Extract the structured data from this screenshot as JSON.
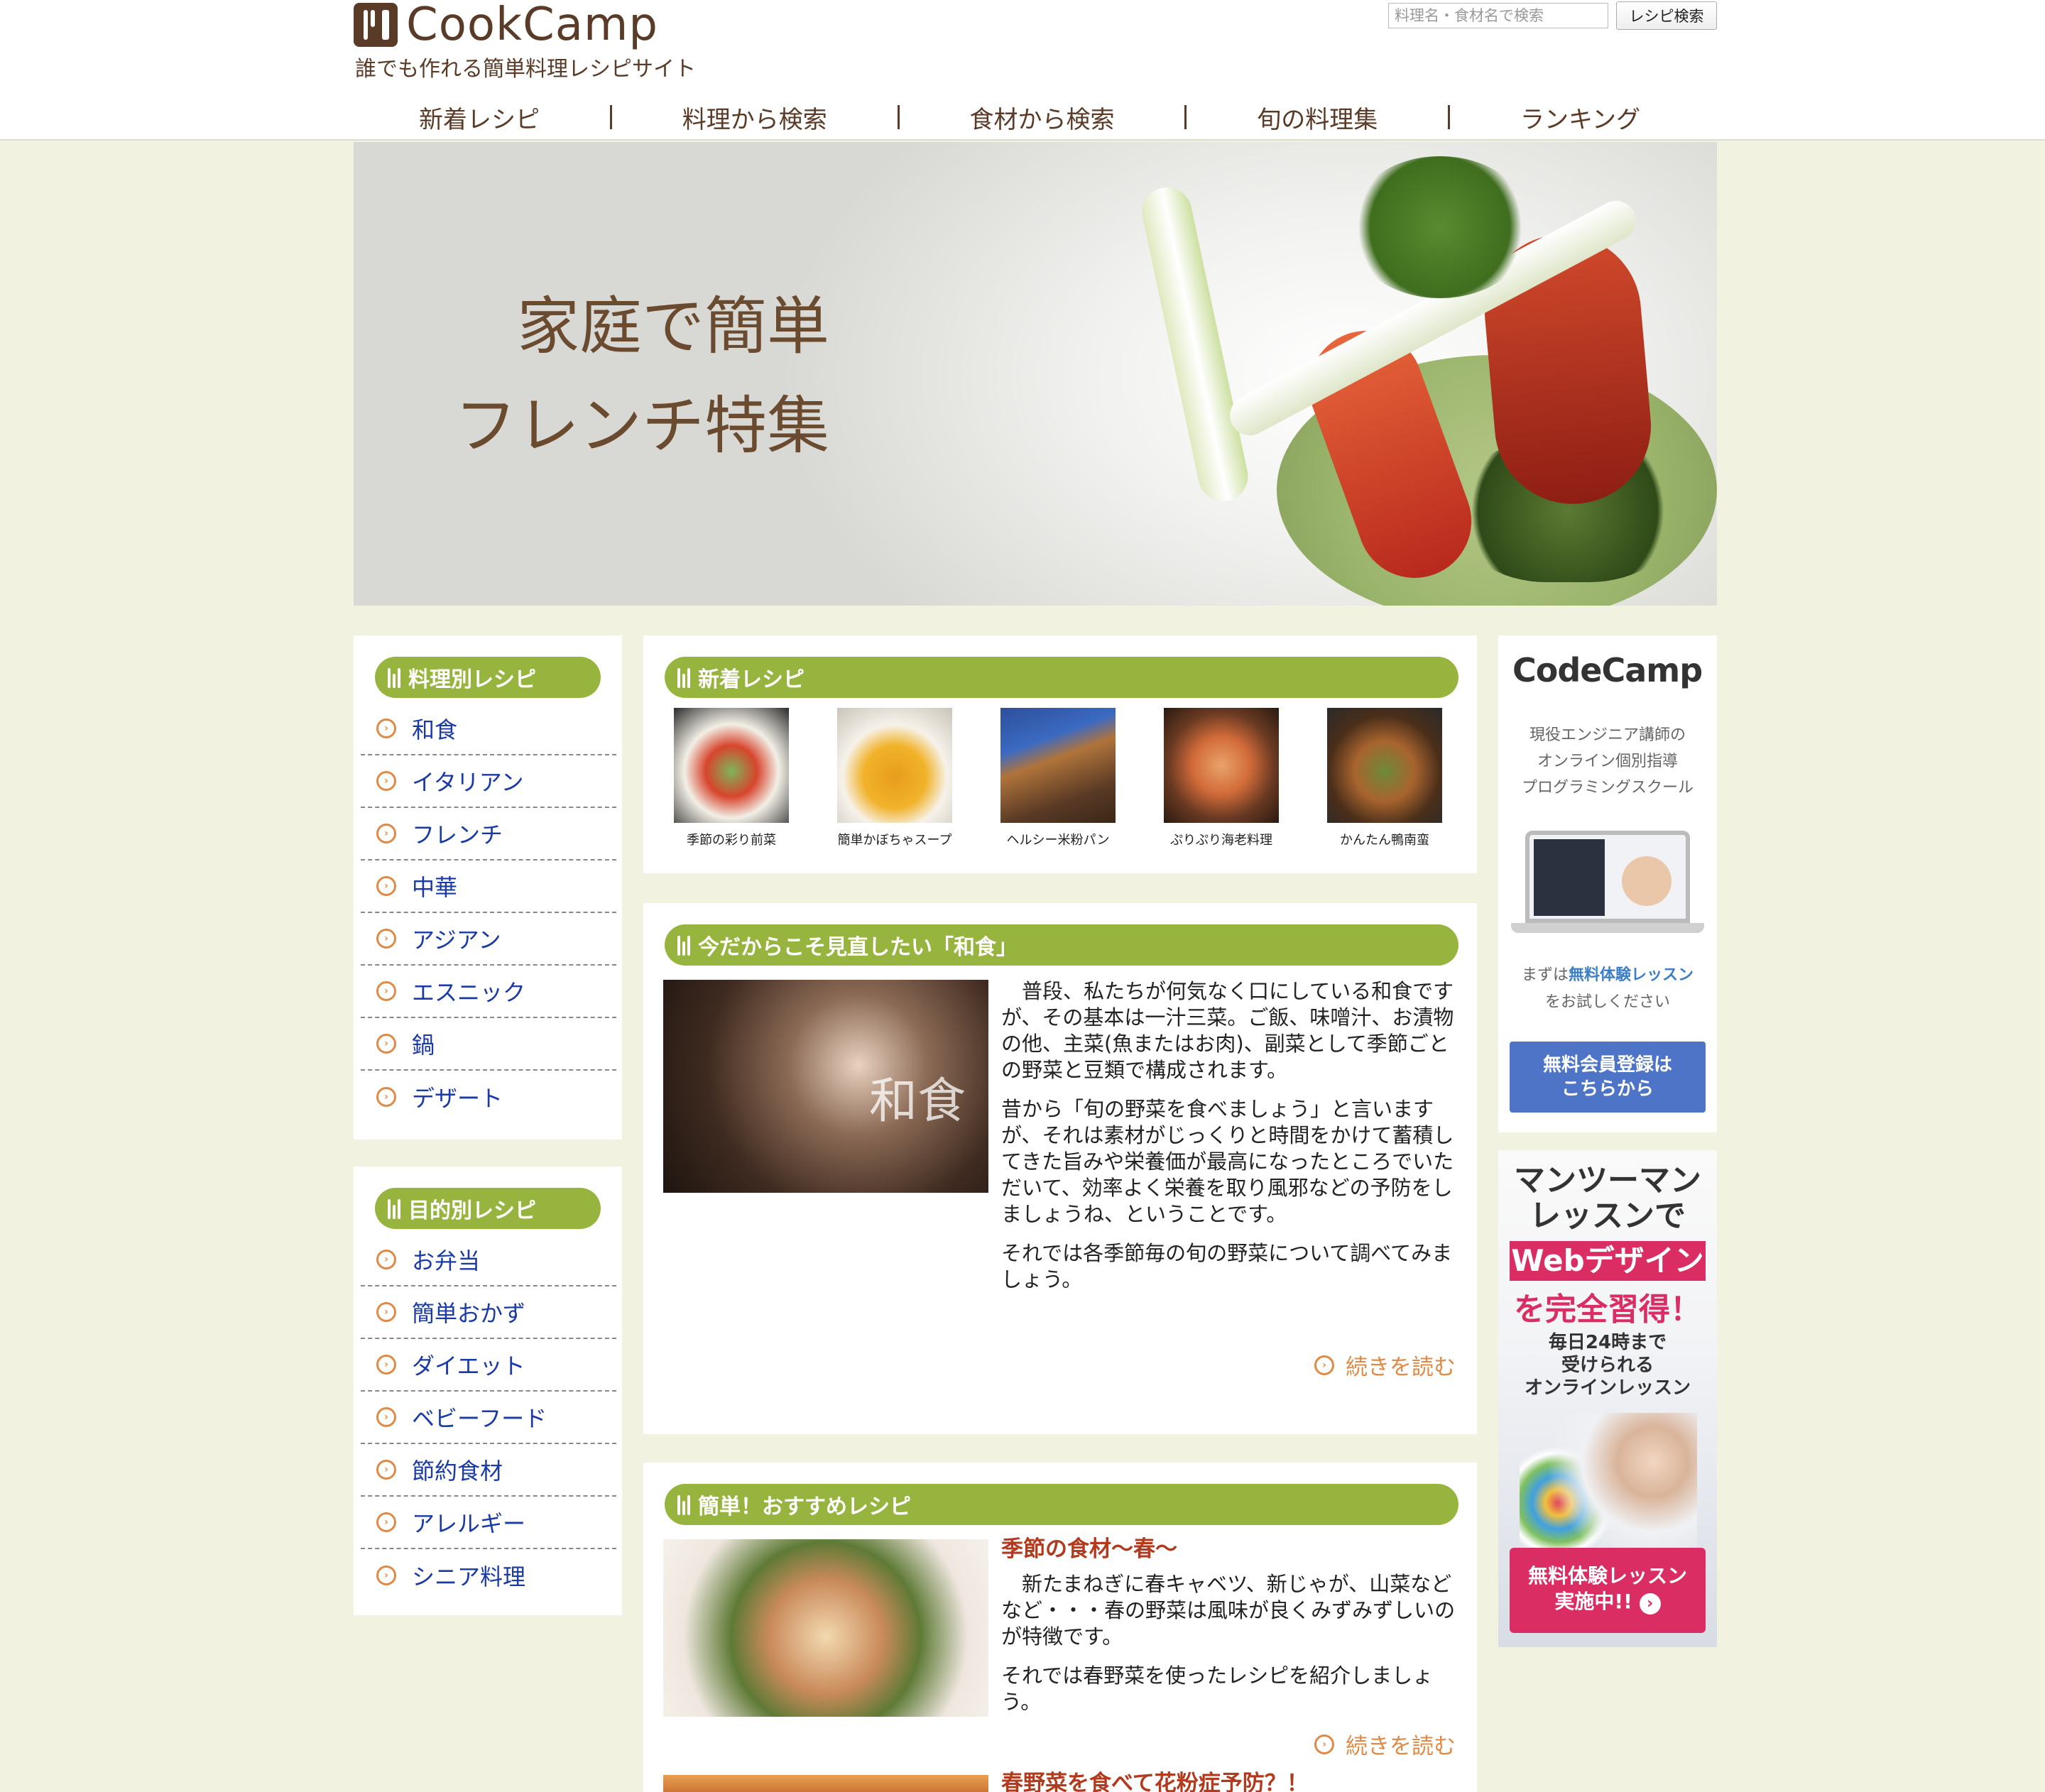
{
  "site": {
    "logo": "CookCamp",
    "tagline": "誰でも作れる簡単料理レシピサイト"
  },
  "search": {
    "placeholder": "料理名・食材名で検索",
    "button": "レシピ検索"
  },
  "nav": [
    "新着レシピ",
    "料理から検索",
    "食材から検索",
    "旬の料理集",
    "ランキング"
  ],
  "hero": {
    "line1": "家庭で簡単",
    "line2": "フレンチ特集"
  },
  "sidebar": {
    "dish_menu": {
      "title": "料理別レシピ",
      "items": [
        "和食",
        "イタリアン",
        "フレンチ",
        "中華",
        "アジアン",
        "エスニック",
        "鍋",
        "デザート"
      ]
    },
    "purpose_menu": {
      "title": "目的別レシピ",
      "items": [
        "お弁当",
        "簡単おかず",
        "ダイエット",
        "ベビーフード",
        "節約食材",
        "アレルギー",
        "シニア料理"
      ]
    }
  },
  "new_recipes": {
    "title": "新着レシピ",
    "items": [
      "季節の彩り前菜",
      "簡単かぼちゃスープ",
      "ヘルシー米粉パン",
      "ぷりぷり海老料理",
      "かんたん鴨南蛮"
    ]
  },
  "washoku": {
    "title": "今だからこそ見直したい「和食」",
    "image_label": "和食",
    "paragraphs": [
      "普段、私たちが何気なく口にしている和食ですが、その基本は一汁三菜。ご飯、味噌汁、お漬物の他、主菜(魚またはお肉)、副菜として季節ごとの野菜と豆類で構成されます。",
      "昔から「旬の野菜を食べましょう」と言いますが、それは素材がじっくりと時間をかけて蓄積してきた旨みや栄養価が最高になったところでいただいて、効率よく栄養を取り風邪などの予防をしましょうね、ということです。",
      "それでは各季節毎の旬の野菜について調べてみましょう。"
    ],
    "more": "続きを読む"
  },
  "recommend": {
    "title": "簡単！おすすめレシピ",
    "article_title": "季節の食材〜春〜",
    "paragraphs": [
      "新たまねぎに春キャベツ、新じゃが、山菜などなど・・・春の野菜は風味が良くみずみずしいのが特徴です。",
      "それでは春野菜を使ったレシピを紹介しましょう。"
    ],
    "more": "続きを読む",
    "next_title": "春野菜を食べて花粉症予防？！"
  },
  "ad_codecamp": {
    "logo": "CodeCamp",
    "subtitle": [
      "現役エンジニア講師の",
      "オンライン個別指導",
      "プログラミングスクール"
    ],
    "trial_highlight": "無料体験レッスン",
    "trial_prefix": "まずは",
    "trial_suffix": "をお試しください",
    "button": [
      "無料会員登録は",
      "こちらから"
    ]
  },
  "ad_lesson": {
    "line1": "マンツーマン",
    "line2": "レッスンで",
    "web": "Webデザイン",
    "line3": "を完全習得！",
    "sub": [
      "毎日24時まで",
      "受けられる",
      "オンラインレッスン"
    ],
    "button": [
      "無料体験レッスン",
      "実施中!!"
    ]
  },
  "colors": {
    "accent_green": "#97b53e",
    "brand_brown": "#5a3b28",
    "link_blue": "#1a3aa6",
    "orange": "#e08a45",
    "background": "#f2f2e1"
  }
}
